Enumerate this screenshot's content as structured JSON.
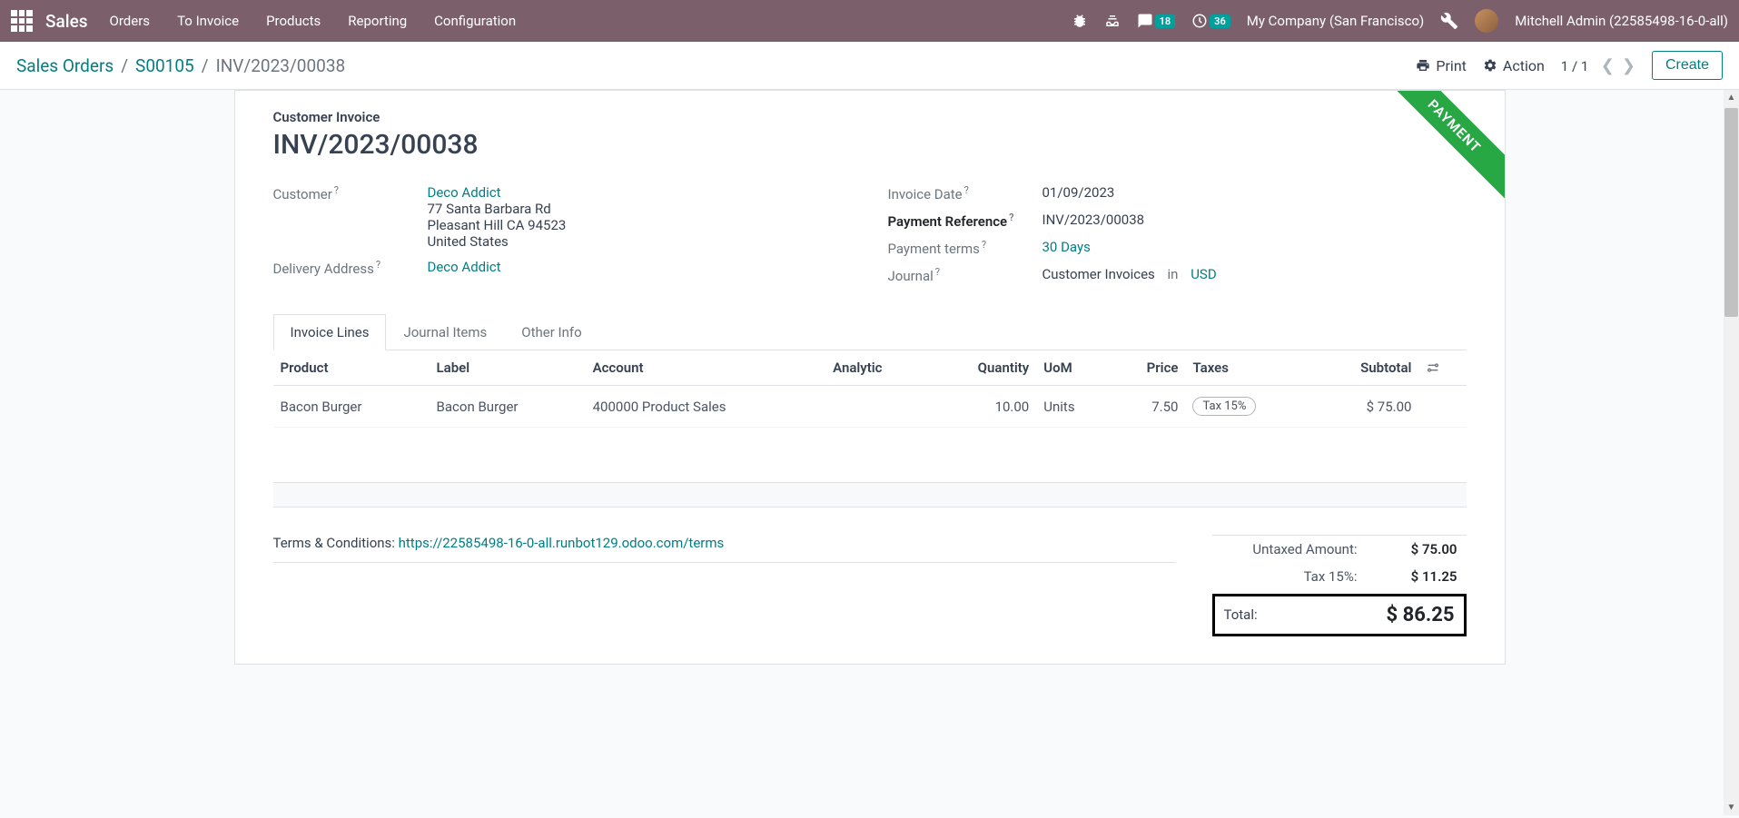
{
  "topbar": {
    "app": "Sales",
    "nav": [
      "Orders",
      "To Invoice",
      "Products",
      "Reporting",
      "Configuration"
    ],
    "msg_count": "18",
    "activity_count": "36",
    "company": "My Company (San Francisco)",
    "user": "Mitchell Admin (22585498-16-0-all)"
  },
  "breadcrumb": {
    "root": "Sales Orders",
    "order": "S00105",
    "current": "INV/2023/00038"
  },
  "controls": {
    "print": "Print",
    "action": "Action",
    "pager": "1 / 1",
    "create": "Create"
  },
  "invoice": {
    "subtitle": "Customer Invoice",
    "title": "INV/2023/00038",
    "ribbon": "PAYMENT",
    "customer_label": "Customer",
    "customer_name": "Deco Addict",
    "customer_addr1": "77 Santa Barbara Rd",
    "customer_addr2": "Pleasant Hill CA 94523",
    "customer_addr3": "United States",
    "delivery_label": "Delivery Address",
    "delivery_value": "Deco Addict",
    "date_label": "Invoice Date",
    "date_value": "01/09/2023",
    "ref_label": "Payment Reference",
    "ref_value": "INV/2023/00038",
    "terms_label": "Payment terms",
    "terms_value": "30 Days",
    "journal_label": "Journal",
    "journal_value": "Customer Invoices",
    "journal_in": "in",
    "journal_currency": "USD"
  },
  "tabs": [
    "Invoice Lines",
    "Journal Items",
    "Other Info"
  ],
  "table": {
    "headers": {
      "product": "Product",
      "label": "Label",
      "account": "Account",
      "analytic": "Analytic",
      "quantity": "Quantity",
      "uom": "UoM",
      "price": "Price",
      "taxes": "Taxes",
      "subtotal": "Subtotal"
    },
    "rows": [
      {
        "product": "Bacon Burger",
        "label": "Bacon Burger",
        "account": "400000 Product Sales",
        "analytic": "",
        "quantity": "10.00",
        "uom": "Units",
        "price": "7.50",
        "taxes": "Tax 15%",
        "subtotal": "$ 75.00"
      }
    ]
  },
  "footer": {
    "terms_label": "Terms & Conditions: ",
    "terms_url": "https://22585498-16-0-all.runbot129.odoo.com/terms",
    "untaxed_label": "Untaxed Amount:",
    "untaxed_value": "$ 75.00",
    "tax_label": "Tax 15%:",
    "tax_value": "$ 11.25",
    "total_label": "Total:",
    "total_value": "$ 86.25"
  }
}
